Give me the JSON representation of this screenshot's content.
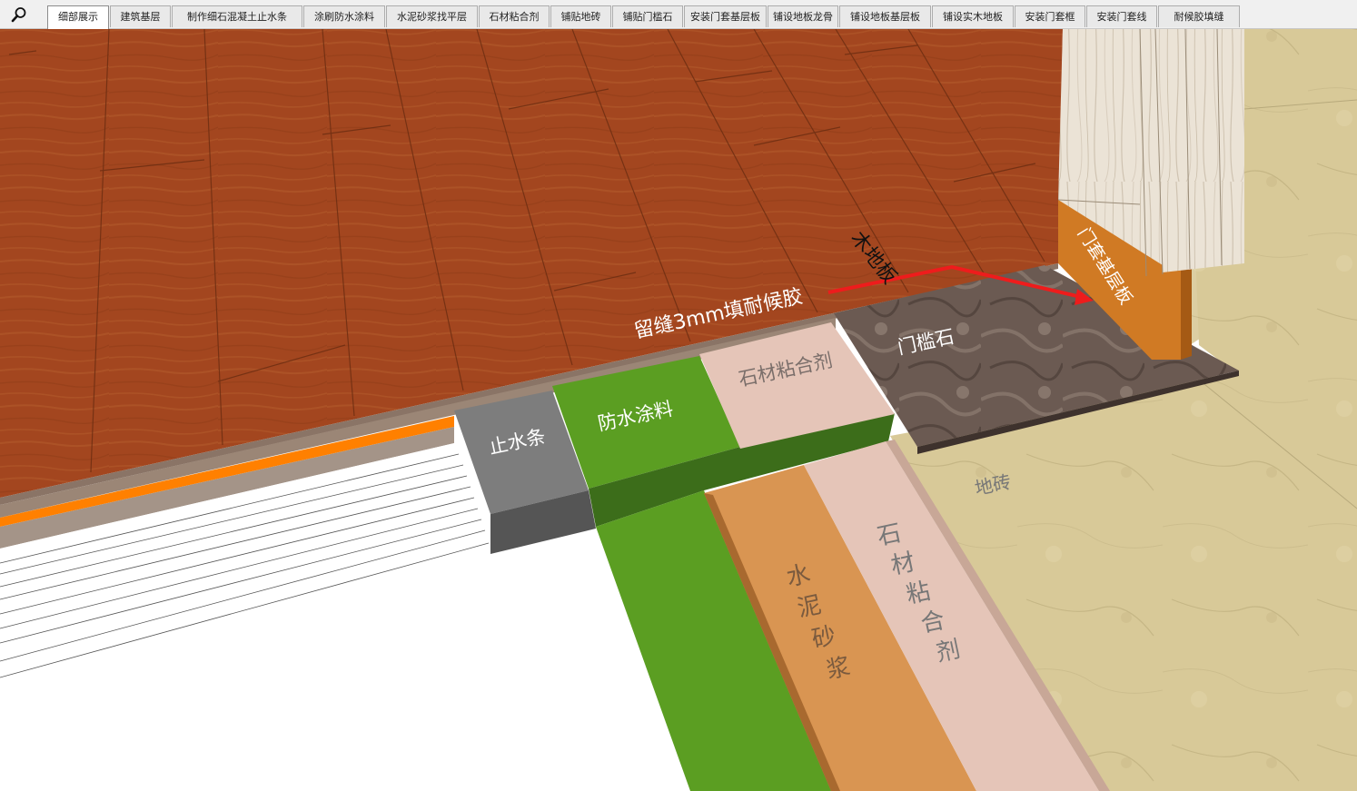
{
  "toolbar": {
    "search_icon": "magnifier-icon",
    "tabs": [
      {
        "label": "细部展示",
        "active": true
      },
      {
        "label": "建筑基层",
        "active": false
      },
      {
        "label": "制作细石混凝土止水条",
        "active": false
      },
      {
        "label": "涂刷防水涂料",
        "active": false
      },
      {
        "label": "水泥砂浆找平层",
        "active": false
      },
      {
        "label": "石材粘合剂",
        "active": false
      },
      {
        "label": "铺贴地砖",
        "active": false
      },
      {
        "label": "铺贴门槛石",
        "active": false
      },
      {
        "label": "安装门套基层板",
        "active": false
      },
      {
        "label": "铺设地板龙骨",
        "active": false
      },
      {
        "label": "铺设地板基层板",
        "active": false
      },
      {
        "label": "铺设实木地板",
        "active": false
      },
      {
        "label": "安装门套框",
        "active": false
      },
      {
        "label": "安装门套线",
        "active": false
      },
      {
        "label": "耐候胶填缝",
        "active": false
      }
    ]
  },
  "scene": {
    "labels": {
      "wood_floor": "木地板",
      "gap_note": "留缝3mm填耐候胶",
      "threshold_stone": "门槛石",
      "stone_adhesive_top": "石材粘合剂",
      "waterproof_coating": "防水涂料",
      "water_stop": "止水条",
      "floor_tile": "地砖",
      "door_base_board": "门套基层板",
      "cement_mortar": "水泥砂浆",
      "stone_adhesive_side": "石材粘合剂"
    },
    "colors": {
      "wood": "#a3461f",
      "green": "#5b9e22",
      "tan_beige": "#e5c5b8",
      "orange_mortar": "#d99552",
      "stone_dark": "#5e4d46",
      "tile": "#d8c998",
      "water_stop_gray": "#7d7d7d",
      "arrow_red": "#ee1c1c",
      "orange_strip": "#ff8000"
    }
  }
}
